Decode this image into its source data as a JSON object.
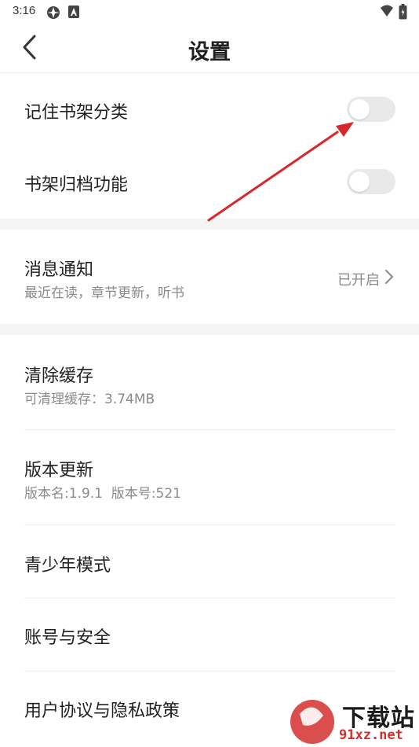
{
  "status_bar": {
    "time": "3:16"
  },
  "header": {
    "title": "设置"
  },
  "settings": {
    "remember_shelf_category": {
      "label": "记住书架分类",
      "enabled": false
    },
    "shelf_archive": {
      "label": "书架归档功能",
      "enabled": false
    },
    "notifications": {
      "label": "消息通知",
      "subtitle": "最近在读，章节更新，听书",
      "value": "已开启"
    },
    "clear_cache": {
      "label": "清除缓存",
      "subtitle": "可清理缓存：3.74MB"
    },
    "version_update": {
      "label": "版本更新",
      "subtitle": "版本名:1.9.1  版本号:521"
    },
    "youth_mode": {
      "label": "青少年模式"
    },
    "account_security": {
      "label": "账号与安全"
    },
    "agreement_privacy": {
      "label": "用户协议与隐私政策"
    }
  },
  "watermark": {
    "text": "下载站",
    "url": "91xz.net"
  },
  "colors": {
    "annotation_arrow": "#d9262b",
    "toggle_off": "#e9e9e9",
    "gap": "#f5f5f5"
  }
}
